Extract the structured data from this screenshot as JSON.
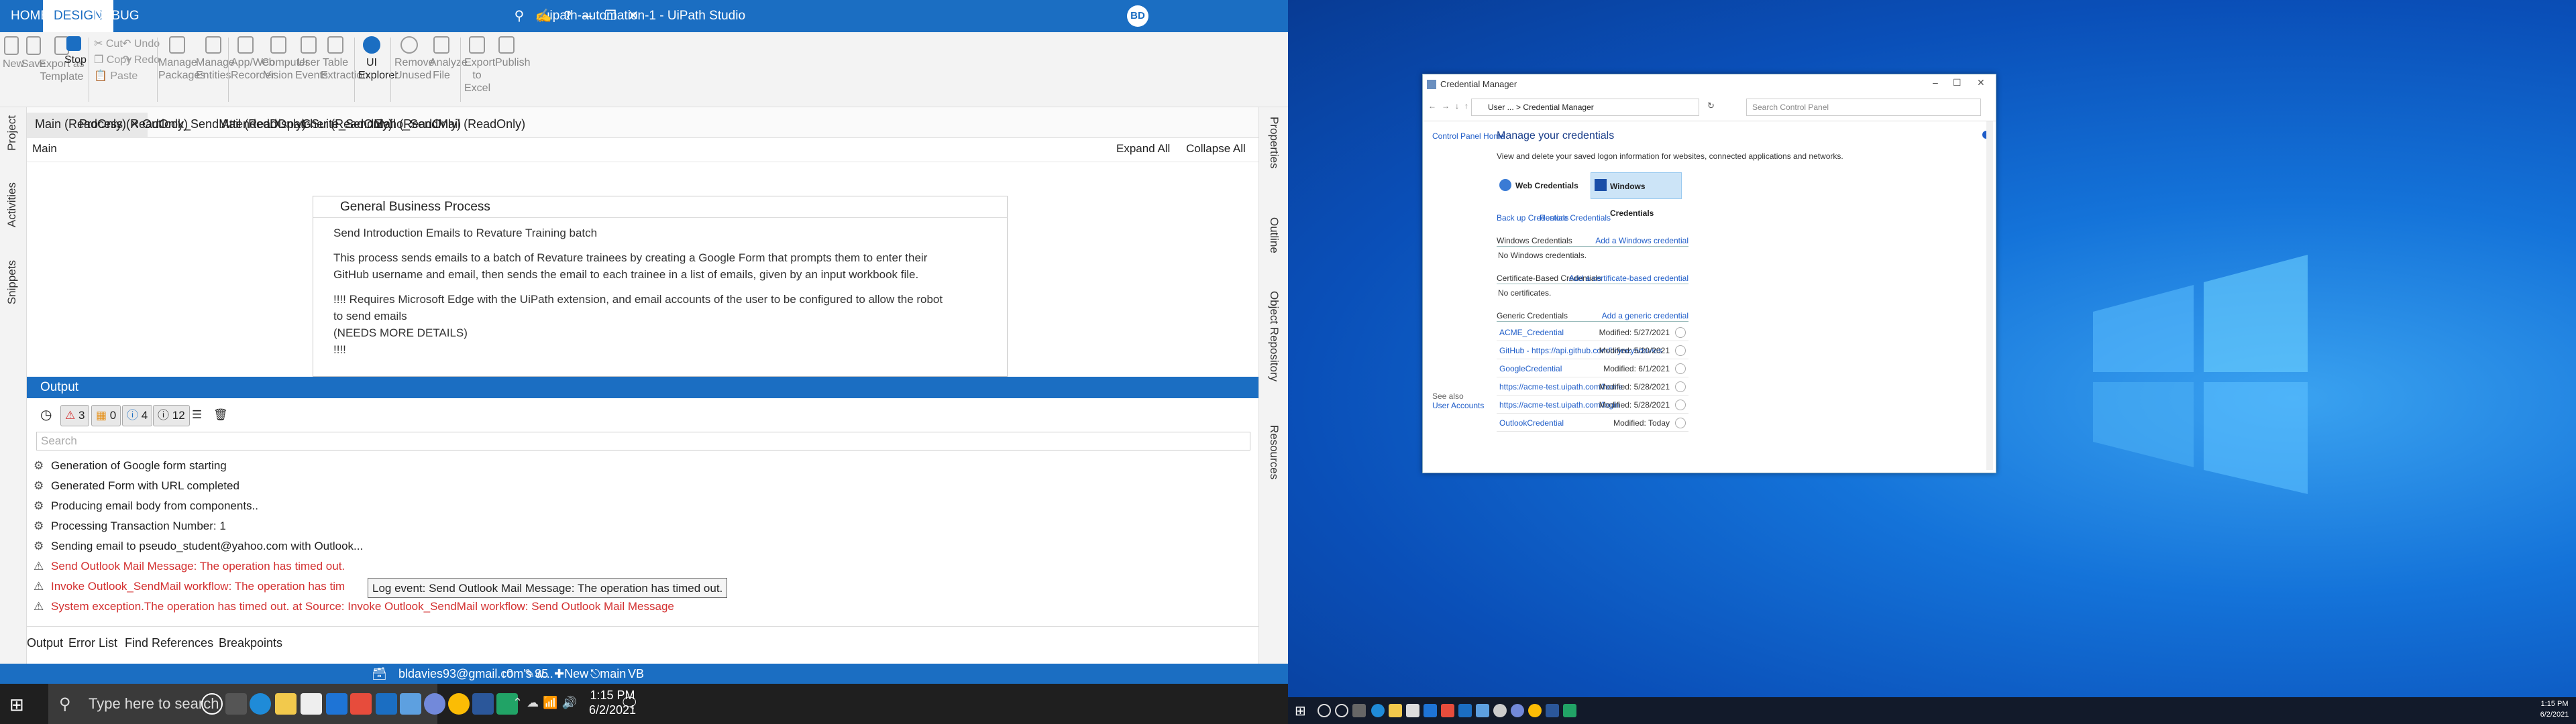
{
  "studio": {
    "title": "uipath-automation-1 - UiPath Studio",
    "tabs": [
      "HOME",
      "DESIGN",
      "DEBUG"
    ],
    "user_initials": "BD",
    "ribbon": {
      "new": "New",
      "save": "Save",
      "export_template": "Export as Template",
      "stop": "Stop",
      "cut": "Cut",
      "copy": "Copy",
      "paste": "Paste",
      "undo": "Undo",
      "redo": "Redo",
      "manage_packages": "Manage Packages",
      "manage_entities": "Manage Entities",
      "app_web_recorder": "App/Web Recorder",
      "computer_vision": "Computer Vision",
      "user_events": "User Events",
      "table_extraction": "Table Extraction",
      "ui_explorer": "UI Explorer",
      "remove_unused": "Remove Unused",
      "analyze_file": "Analyze File",
      "export_excel": "Export to Excel",
      "publish": "Publish"
    },
    "left_panels": [
      "Project",
      "Activities",
      "Snippets"
    ],
    "right_panels": [
      "Properties",
      "Outline",
      "Object Repository",
      "Resources"
    ],
    "doc_tabs": [
      "Main (ReadOnly)",
      "Process (ReadOnly)",
      "Outlook_SendMail (ReadOnly)",
      "AttendedDispatcher (ReadOnly)",
      "GSuite_SendMail (ReadOnly)",
      "Zoho_SendMail (ReadOnly)"
    ],
    "breadcrumb": "Main",
    "expand_all": "Expand All",
    "collapse_all": "Collapse All",
    "sequence": {
      "title": "General Business Process",
      "lines": [
        "Send Introduction Emails to Revature Training batch",
        "",
        "This process sends emails to a batch of Revature trainees by creating a Google Form that prompts them to enter their",
        "GitHub username and email, then sends the email to each trainee in a list of emails, given by an input workbook file.",
        "",
        "!!!! Requires Microsoft Edge with the UiPath extension, and email accounts of the user to be configured to allow the robot",
        "to send emails",
        "(NEEDS MORE DETAILS)",
        "!!!!"
      ]
    },
    "output": {
      "title": "Output",
      "filters": {
        "errors": "3",
        "warnings": "0",
        "info": "4",
        "trace": "12"
      },
      "search_placeholder": "Search",
      "logs": [
        {
          "text": "Generation of Google form starting",
          "level": "info"
        },
        {
          "text": "Generated Form with URL completed",
          "level": "info"
        },
        {
          "text": "Producing email body from components..",
          "level": "info"
        },
        {
          "text": "Processing Transaction Number: 1",
          "level": "info"
        },
        {
          "text": "Sending email to pseudo_student@yahoo.com with Outlook...",
          "level": "info"
        },
        {
          "text": "Send Outlook Mail Message: The operation has timed out.",
          "level": "error"
        },
        {
          "text": "Invoke Outlook_SendMail workflow: The operation has tim",
          "level": "error"
        },
        {
          "text": "System exception.The operation has timed out. at Source: Invoke Outlook_SendMail workflow: Send Outlook Mail Message",
          "level": "error"
        }
      ],
      "tooltip": "Log event: Send Outlook Mail Message: The operation has timed out."
    },
    "bottom_tabs": [
      "Output",
      "Error List",
      "Find References",
      "Breakpoints"
    ],
    "status": {
      "account": "bldavies93@gmail.com's w...",
      "changes": "0",
      "commits": "35",
      "new_folder": "New folder",
      "branch": "main",
      "lang": "VB"
    }
  },
  "taskbar_left": {
    "search_placeholder": "Type here to search",
    "time": "1:15 PM",
    "date": "6/2/2021"
  },
  "credman": {
    "title": "Credential Manager",
    "address": "User ... > Credential Manager",
    "search_placeholder": "Search Control Panel",
    "home_link": "Control Panel Home",
    "heading": "Manage your credentials",
    "subheading": "View and delete your saved logon information for websites, connected applications and networks.",
    "web_credentials": "Web Credentials",
    "windows_credentials": "Windows Credentials",
    "backup": "Back up Credentials",
    "restore": "Restore Credentials",
    "windows_section": "Windows Credentials",
    "add_windows": "Add a Windows credential",
    "no_windows": "No Windows credentials.",
    "cert_section": "Certificate-Based Credentials",
    "add_cert": "Add a certificate-based credential",
    "no_cert": "No certificates.",
    "generic_section": "Generic Credentials",
    "add_generic": "Add a generic credential",
    "see_also": "See also",
    "user_accounts": "User Accounts",
    "generic": [
      {
        "name": "ACME_Credential",
        "modified": "Modified:  5/27/2021"
      },
      {
        "name": "GitHub - https://api.github.com/bryneyndavies",
        "modified": "Modified:  5/20/2021"
      },
      {
        "name": "GoogleCredential",
        "modified": "Modified:  6/1/2021"
      },
      {
        "name": "https://acme-test.uipath.com/home",
        "modified": "Modified:  5/28/2021"
      },
      {
        "name": "https://acme-test.uipath.com/login",
        "modified": "Modified:  5/28/2021"
      },
      {
        "name": "OutlookCredential",
        "modified": "Modified:  Today"
      }
    ]
  },
  "taskbar_right": {
    "time": "1:15 PM",
    "date": "6/2/2021"
  }
}
